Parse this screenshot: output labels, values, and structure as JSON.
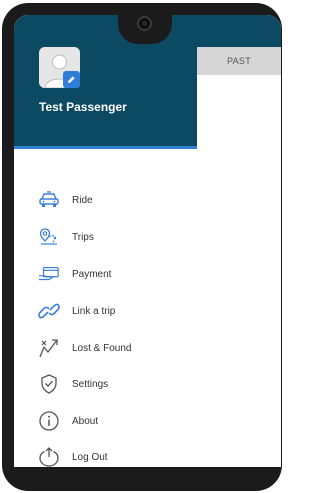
{
  "tabs": {
    "past_label": "PAST"
  },
  "user": {
    "name": "Test Passenger"
  },
  "menu": {
    "items": [
      {
        "label": "Ride",
        "icon": "car-icon"
      },
      {
        "label": "Trips",
        "icon": "map-pin-icon"
      },
      {
        "label": "Payment",
        "icon": "payment-card-icon"
      },
      {
        "label": "Link a trip",
        "icon": "link-icon"
      },
      {
        "label": "Lost & Found",
        "icon": "lost-found-icon"
      },
      {
        "label": "Settings",
        "icon": "shield-icon"
      },
      {
        "label": "About",
        "icon": "info-icon"
      },
      {
        "label": "Log Out",
        "icon": "power-icon"
      }
    ]
  },
  "colors": {
    "header": "#0c4a63",
    "accent": "#2e7fd6",
    "icon_blue": "#3b7fd8",
    "icon_gray": "#555555"
  }
}
